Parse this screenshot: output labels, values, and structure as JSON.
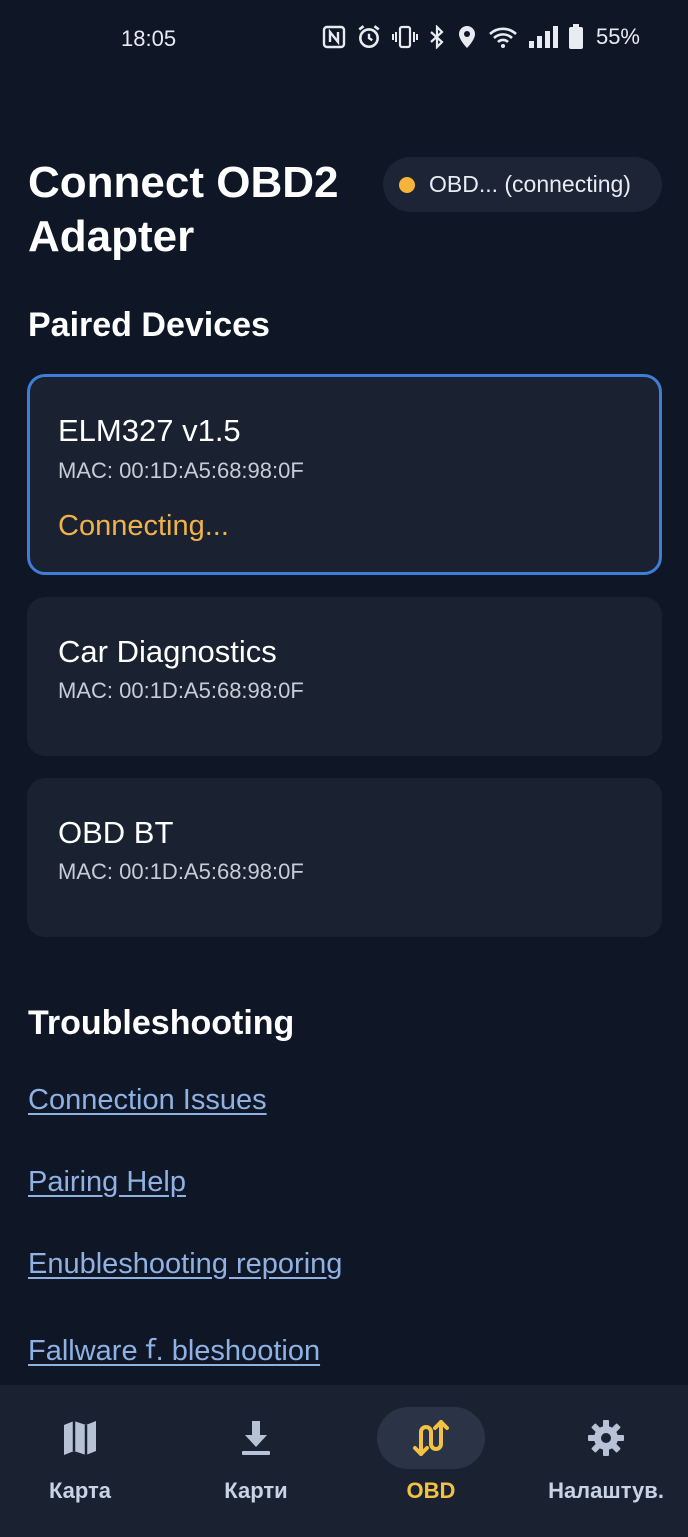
{
  "status_bar": {
    "time": "18:05",
    "icons": [
      "nfc-icon",
      "alarm-icon",
      "vibrate-icon",
      "bluetooth-icon",
      "location-icon",
      "wifi-icon",
      "signal-icon",
      "battery-icon"
    ],
    "battery": "55%"
  },
  "header": {
    "title": "Connect OBD2 Adapter",
    "status_chip": "OBD... (connecting)",
    "status_color": "#f6b43a"
  },
  "paired": {
    "title": "Paired Devices",
    "devices": [
      {
        "name": "ELM327 v1.5",
        "mac": "MAC: 00:1D:A5:68:98:0F",
        "status": "Connecting..."
      },
      {
        "name": "Car Diagnostics",
        "mac": "MAC: 00:1D:A5:68:98:0F"
      },
      {
        "name": "OBD BT",
        "mac": "MAC: 00:1D:A5:68:98:0F"
      }
    ]
  },
  "troubleshooting": {
    "title": "Troubleshooting",
    "links": [
      "Connection Issues",
      "Pairing Help",
      "Enubleshooting reporing",
      "Fallware ꬵ. bleshootion"
    ]
  },
  "nav": {
    "items": [
      {
        "label": "Карта",
        "icon": "map-icon"
      },
      {
        "label": "Карти",
        "icon": "download-icon"
      },
      {
        "label": "OBD",
        "icon": "obd-icon",
        "active": true
      },
      {
        "label": "Налаштув.",
        "icon": "gear-icon"
      }
    ],
    "active_color": "#f4c242"
  }
}
